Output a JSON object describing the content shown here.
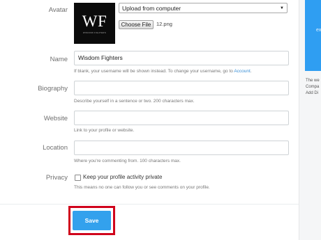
{
  "form": {
    "avatar": {
      "label": "Avatar",
      "image_text": "WF",
      "image_subtext": "WISDOM FIGHTERS",
      "source_select": "Upload from computer",
      "choose_file_label": "Choose File",
      "file_name": "12.png"
    },
    "name": {
      "label": "Name",
      "value": "Wisdom Fighters",
      "help_prefix": "If blank, your username will be shown instead. To change your username, go to ",
      "help_link": "Account",
      "help_suffix": "."
    },
    "biography": {
      "label": "Biography",
      "value": "",
      "help": "Describe yourself in a sentence or two. 200 characters max."
    },
    "website": {
      "label": "Website",
      "value": "",
      "help": "Link to your profile or website."
    },
    "location": {
      "label": "Location",
      "value": "",
      "help": "Where you're commenting from. 100 characters max."
    },
    "privacy": {
      "label": "Privacy",
      "checkbox_label": "Keep your profile activity private",
      "checked": false,
      "help": "This means no one can follow you or see comments on your profile."
    },
    "save_label": "Save"
  },
  "sidebar": {
    "banner_text": "ex",
    "line1": "The we",
    "line2": "Compa",
    "line3": "Add Di"
  },
  "colors": {
    "accent": "#33a1ed",
    "highlight": "#d0021b",
    "banner": "#2f9ef2"
  }
}
